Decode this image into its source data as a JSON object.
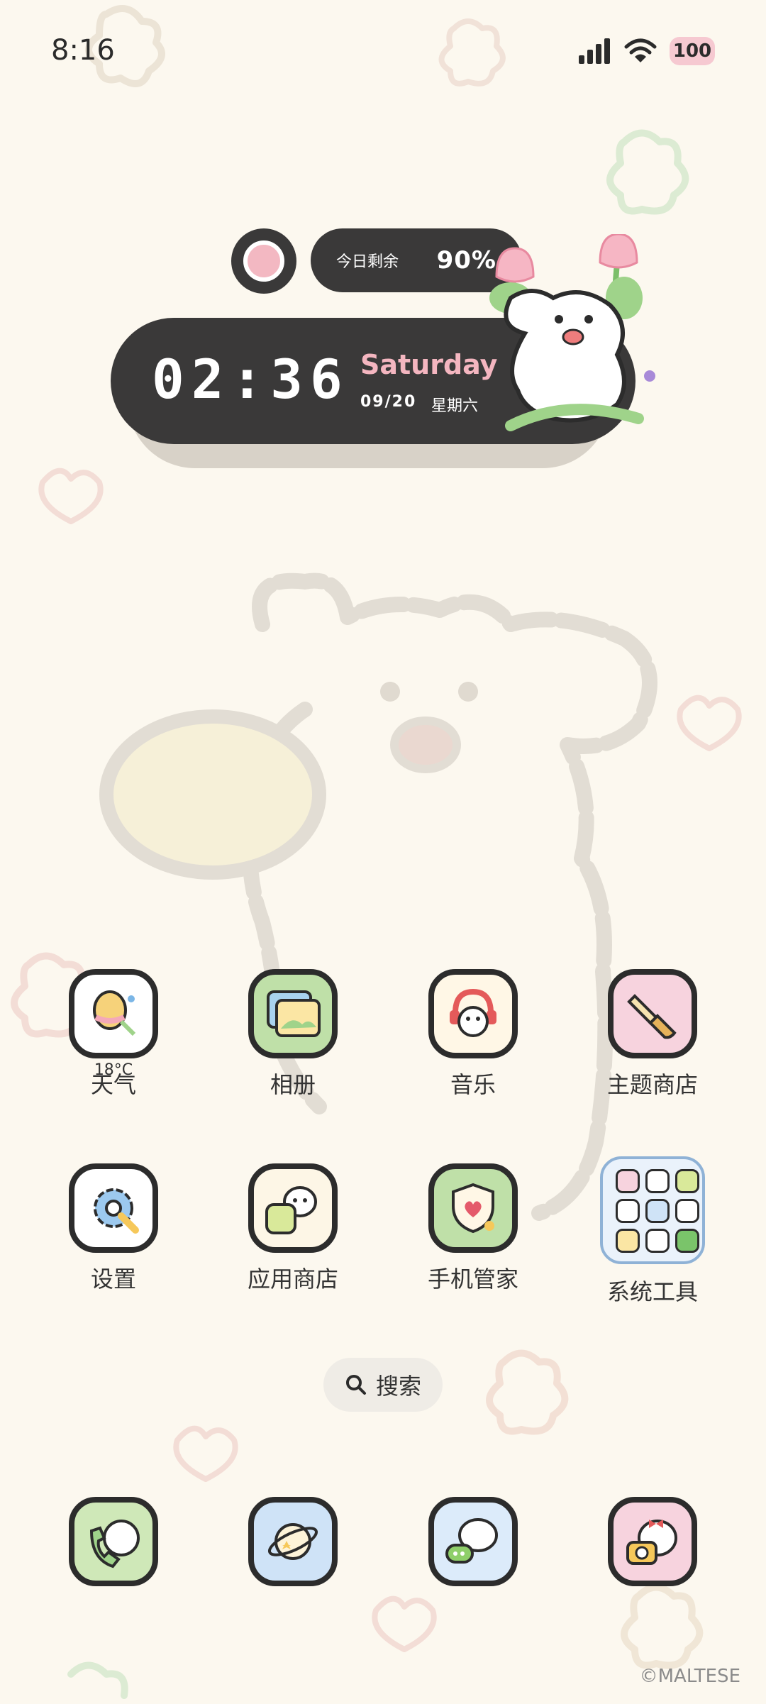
{
  "status_bar": {
    "time": "8:16",
    "battery": "100"
  },
  "widget": {
    "remaining_label": "今日剩余",
    "remaining_value": "90%",
    "time": "02:36",
    "weekday_en": "Saturday",
    "date": "09/20",
    "weekday_cn": "星期六"
  },
  "apps_row1": [
    {
      "label": "天气",
      "sub": "18°C",
      "icon": "weather-icon"
    },
    {
      "label": "相册",
      "icon": "gallery-icon"
    },
    {
      "label": "音乐",
      "icon": "music-icon"
    },
    {
      "label": "主题商店",
      "icon": "theme-store-icon"
    }
  ],
  "apps_row2": [
    {
      "label": "设置",
      "icon": "settings-icon"
    },
    {
      "label": "应用商店",
      "icon": "app-store-icon"
    },
    {
      "label": "手机管家",
      "icon": "phone-manager-icon"
    },
    {
      "label": "系统工具",
      "icon": "system-tools-folder-icon"
    }
  ],
  "search": {
    "label": "搜索"
  },
  "dock": [
    {
      "icon": "phone-icon"
    },
    {
      "icon": "browser-icon"
    },
    {
      "icon": "messages-icon"
    },
    {
      "icon": "camera-icon"
    }
  ],
  "watermark": "©MALTESE",
  "colors": {
    "background": "#fcf8ef",
    "widget": "#3a3939",
    "accent_pink": "#f4b6c0"
  }
}
